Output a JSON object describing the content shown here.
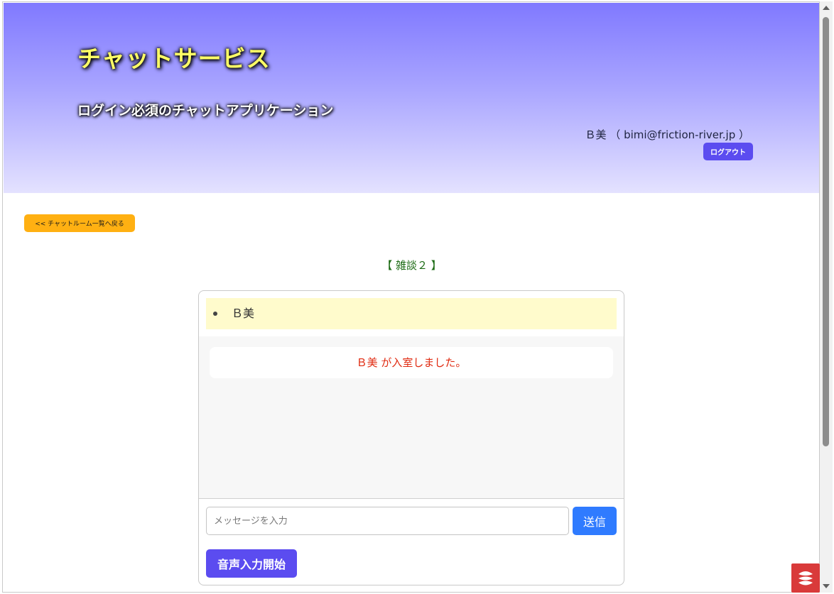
{
  "header": {
    "title": "チャットサービス",
    "subtitle": "ログイン必須のチャットアプリケーション",
    "user": "Ｂ美 （ bimi@friction-river.jp ）",
    "logout_label": "ログアウト"
  },
  "nav": {
    "back_label": "<< チャットルーム一覧へ戻る"
  },
  "room": {
    "title": "【 雑談２ 】",
    "members": [
      "Ｂ美"
    ],
    "messages": [
      {
        "type": "system",
        "text": "Ｂ美 が入室しました。"
      }
    ]
  },
  "composer": {
    "input_value": "",
    "input_placeholder": "メッセージを入力",
    "send_label": "送信",
    "voice_label": "音声入力開始"
  },
  "colors": {
    "header_gradient_top": "#8079ff",
    "header_gradient_bottom": "#e4e2ff",
    "title_text": "#ffff66",
    "primary_button": "#5b4cf0",
    "send_button": "#2f7bff",
    "back_button": "#ffb012",
    "room_title": "#1c6b14",
    "system_message": "#e02a10",
    "members_background": "#fffbcc"
  }
}
